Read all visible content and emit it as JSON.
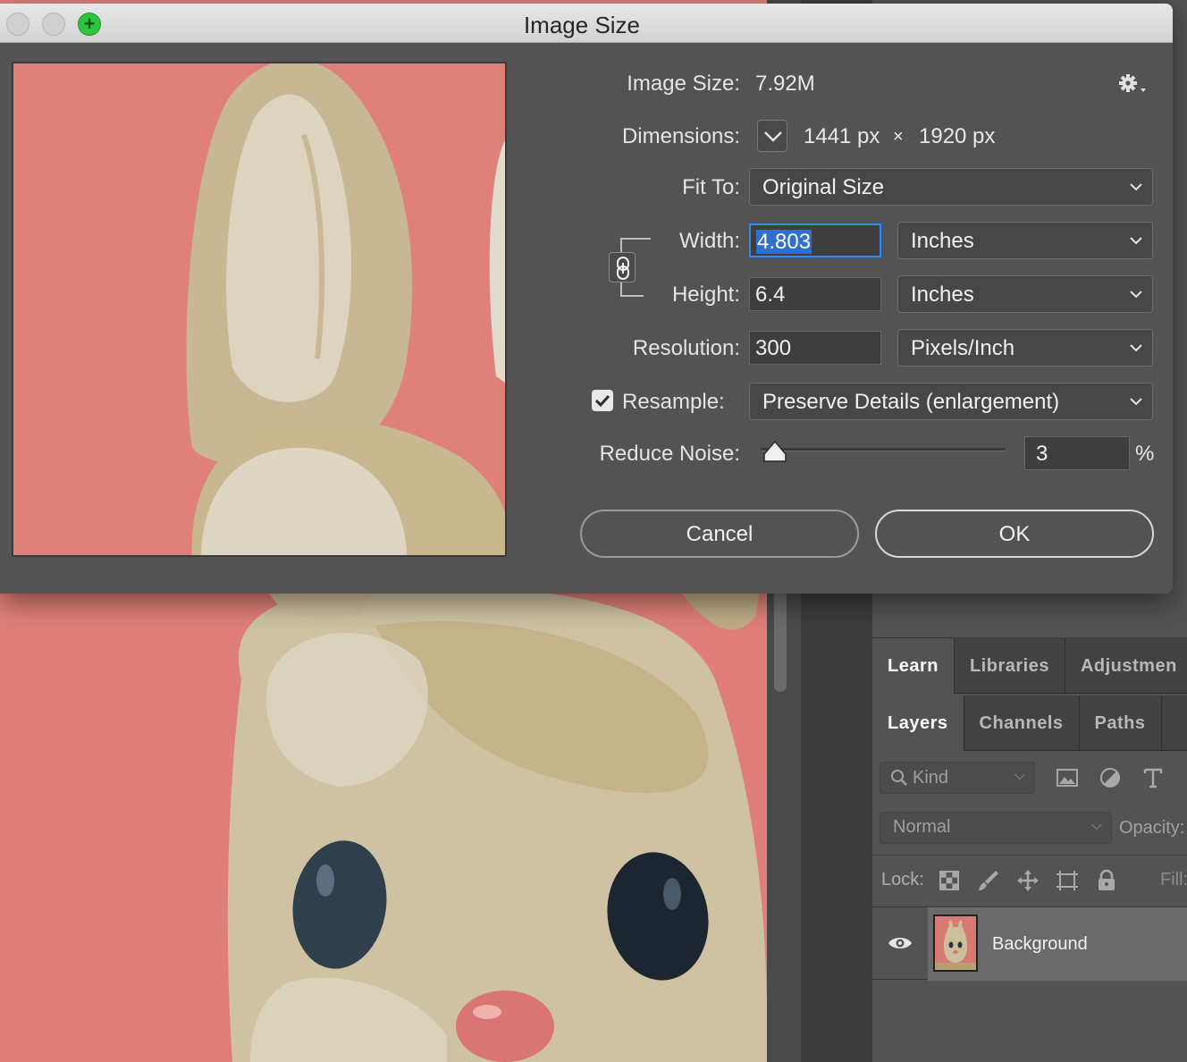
{
  "dialog": {
    "title": "Image Size",
    "image_size_label": "Image Size:",
    "image_size_value": "7.92M",
    "dimensions_label": "Dimensions:",
    "dimensions_width": "1441 px",
    "dimensions_times": "×",
    "dimensions_height": "1920 px",
    "fit_to_label": "Fit To:",
    "fit_to_value": "Original Size",
    "width_label": "Width:",
    "width_value": "4.803",
    "width_unit": "Inches",
    "height_label": "Height:",
    "height_value": "6.4",
    "height_unit": "Inches",
    "resolution_label": "Resolution:",
    "resolution_value": "300",
    "resolution_unit": "Pixels/Inch",
    "resample_label": "Resample:",
    "resample_checked": true,
    "resample_method": "Preserve Details (enlargement)",
    "reduce_noise_label": "Reduce Noise:",
    "reduce_noise_value": "3",
    "reduce_noise_unit": "%",
    "cancel_label": "Cancel",
    "ok_label": "OK"
  },
  "panel": {
    "top_tabs": [
      "Learn",
      "Libraries",
      "Adjustmen"
    ],
    "active_top_tab": "Learn",
    "layer_tabs": [
      "Layers",
      "Channels",
      "Paths"
    ],
    "active_layer_tab": "Layers",
    "filter_placeholder": "Kind",
    "blend_mode": "Normal",
    "opacity_label": "Opacity:",
    "lock_label": "Lock:",
    "fill_label": "Fill:",
    "layers": [
      {
        "name": "Background",
        "visible": true
      }
    ]
  },
  "colors": {
    "accent_focus": "#3f86e0",
    "zoom_button": "#2fc43f",
    "dialog_bg": "#535353",
    "canvas_pink": "#e1807b"
  },
  "icons": [
    "gear-icon",
    "chain-link-icon",
    "search-icon",
    "image-filter-icon",
    "adjustment-filter-icon",
    "type-filter-icon",
    "lock-transparency-icon",
    "brush-lock-icon",
    "move-lock-icon",
    "artboard-lock-icon",
    "padlock-icon",
    "eye-icon"
  ]
}
